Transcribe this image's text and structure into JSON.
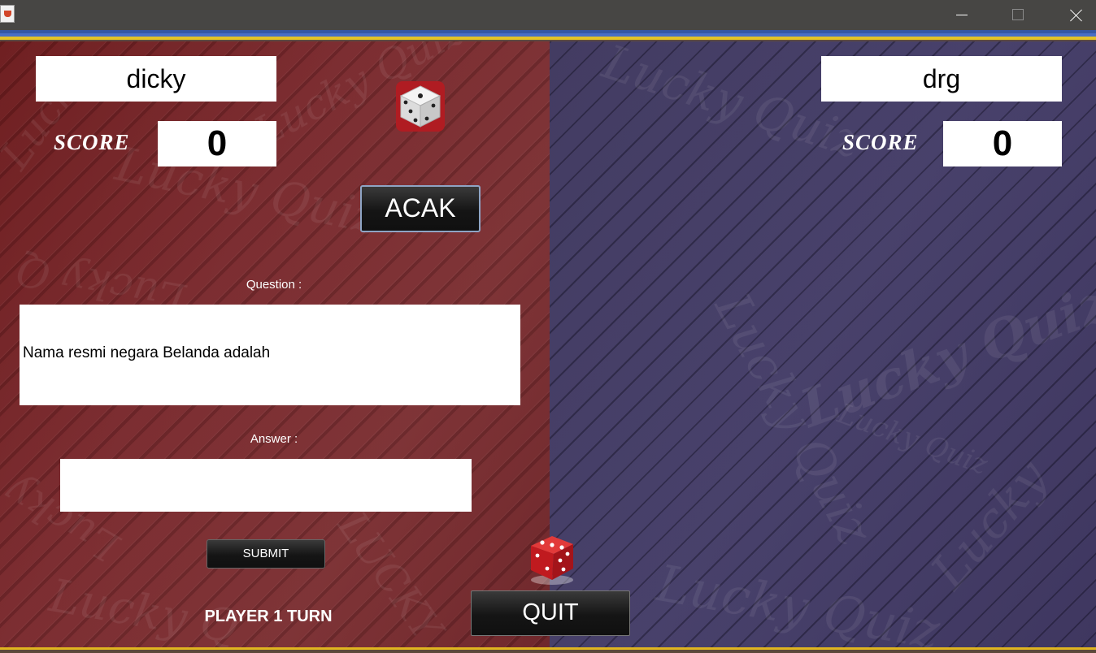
{
  "window": {
    "icon": "java-cup-icon",
    "buttons": [
      "minimize",
      "maximize",
      "close"
    ]
  },
  "player1": {
    "name": "dicky",
    "score_label": "SCORE",
    "score": "0"
  },
  "player2": {
    "name": "drg",
    "score_label": "SCORE",
    "score": "0"
  },
  "roll_button_label": "ACAK",
  "question": {
    "label": "Question :",
    "text": "Nama resmi negara Belanda adalah"
  },
  "answer": {
    "label": "Answer :",
    "value": ""
  },
  "submit_label": "SUBMIT",
  "turn_status": "PLAYER 1 TURN",
  "quit_label": "QUIT",
  "colors": {
    "left_panel": "#7a2a2e",
    "right_panel": "#423b66",
    "stripe_blue": "#3557a5",
    "stripe_yellow": "#e4c328"
  }
}
